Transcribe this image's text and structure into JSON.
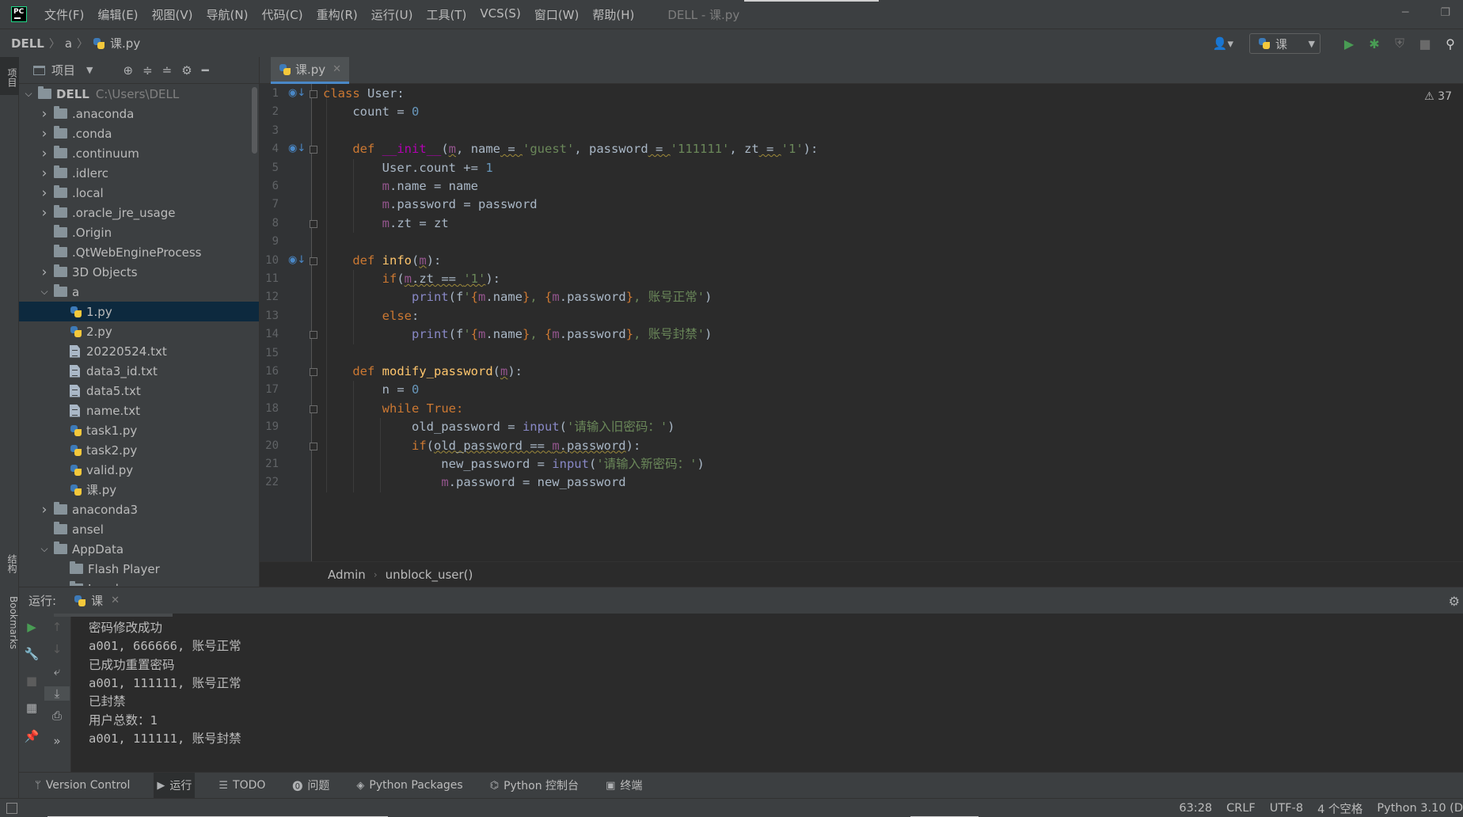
{
  "menubar": {
    "items": [
      "文件(F)",
      "编辑(E)",
      "视图(V)",
      "导航(N)",
      "代码(C)",
      "重构(R)",
      "运行(U)",
      "工具(T)",
      "VCS(S)",
      "窗口(W)",
      "帮助(H)"
    ],
    "window_title": "DELL - 课.py"
  },
  "navbar": {
    "breadcrumb": [
      "DELL",
      "a",
      "课.py"
    ],
    "run_config": "课"
  },
  "left_strip": {
    "project_tab": "项目",
    "structure_tab": "结构",
    "bookmarks_tab": "Bookmarks"
  },
  "project": {
    "title": "项目",
    "root": {
      "name": "DELL",
      "path": "C:\\Users\\DELL"
    },
    "items": [
      {
        "name": ".anaconda",
        "kind": "folder",
        "depth": 1,
        "expanded": false,
        "has_children": true
      },
      {
        "name": ".conda",
        "kind": "folder",
        "depth": 1,
        "expanded": false,
        "has_children": true
      },
      {
        "name": ".continuum",
        "kind": "folder",
        "depth": 1,
        "expanded": false,
        "has_children": true
      },
      {
        "name": ".idlerc",
        "kind": "folder",
        "depth": 1,
        "expanded": false,
        "has_children": true
      },
      {
        "name": ".local",
        "kind": "folder",
        "depth": 1,
        "expanded": false,
        "has_children": true
      },
      {
        "name": ".oracle_jre_usage",
        "kind": "folder",
        "depth": 1,
        "expanded": false,
        "has_children": true
      },
      {
        "name": ".Origin",
        "kind": "folder",
        "depth": 1,
        "expanded": false,
        "has_children": false
      },
      {
        "name": ".QtWebEngineProcess",
        "kind": "folder",
        "depth": 1,
        "expanded": false,
        "has_children": false
      },
      {
        "name": "3D Objects",
        "kind": "folder",
        "depth": 1,
        "expanded": false,
        "has_children": true
      },
      {
        "name": "a",
        "kind": "folder",
        "depth": 1,
        "expanded": true,
        "has_children": true
      },
      {
        "name": "1.py",
        "kind": "py",
        "depth": 2,
        "selected": true
      },
      {
        "name": "2.py",
        "kind": "py",
        "depth": 2
      },
      {
        "name": "20220524.txt",
        "kind": "txt",
        "depth": 2
      },
      {
        "name": "data3_id.txt",
        "kind": "txt",
        "depth": 2
      },
      {
        "name": "data5.txt",
        "kind": "txt",
        "depth": 2
      },
      {
        "name": "name.txt",
        "kind": "txt",
        "depth": 2
      },
      {
        "name": "task1.py",
        "kind": "py",
        "depth": 2
      },
      {
        "name": "task2.py",
        "kind": "py",
        "depth": 2
      },
      {
        "name": "valid.py",
        "kind": "py",
        "depth": 2
      },
      {
        "name": "课.py",
        "kind": "py",
        "depth": 2
      },
      {
        "name": "anaconda3",
        "kind": "folder",
        "depth": 1,
        "expanded": false,
        "has_children": true
      },
      {
        "name": "ansel",
        "kind": "folder",
        "depth": 1,
        "expanded": false,
        "has_children": false
      },
      {
        "name": "AppData",
        "kind": "folder",
        "depth": 1,
        "expanded": true,
        "has_children": true
      },
      {
        "name": "Flash Player",
        "kind": "folder",
        "depth": 2,
        "expanded": false,
        "has_children": false
      },
      {
        "name": "Local",
        "kind": "folder",
        "depth": 2,
        "expanded": true,
        "has_children": true
      }
    ]
  },
  "editor": {
    "tab_label": "课.py",
    "warning_count": "37",
    "line_numbers": [
      "1",
      "2",
      "3",
      "4",
      "5",
      "6",
      "7",
      "8",
      "9",
      "10",
      "11",
      "12",
      "13",
      "14",
      "15",
      "16",
      "17",
      "18",
      "19",
      "20",
      "21",
      "22"
    ],
    "code_lines": [
      [
        {
          "t": "class",
          "c": "kw"
        },
        {
          "t": " User:"
        }
      ],
      [
        {
          "t": "    count = "
        },
        {
          "t": "0",
          "c": "num"
        }
      ],
      [],
      [
        {
          "t": "    "
        },
        {
          "t": "def",
          "c": "kw"
        },
        {
          "t": " "
        },
        {
          "t": "__init__",
          "c": "dunder"
        },
        {
          "t": "("
        },
        {
          "t": "m",
          "c": "self warn-ul"
        },
        {
          "t": ", "
        },
        {
          "t": "name",
          "c": ""
        },
        {
          "t": " = ",
          "c": "warn-ul"
        },
        {
          "t": "'guest'",
          "c": "str"
        },
        {
          "t": ", password"
        },
        {
          "t": " = ",
          "c": "warn-ul"
        },
        {
          "t": "'111111'",
          "c": "str"
        },
        {
          "t": ", zt"
        },
        {
          "t": " = ",
          "c": "warn-ul"
        },
        {
          "t": "'1'",
          "c": "str"
        },
        {
          "t": "):"
        }
      ],
      [
        {
          "t": "        User.count += "
        },
        {
          "t": "1",
          "c": "num"
        }
      ],
      [
        {
          "t": "        "
        },
        {
          "t": "m",
          "c": "self"
        },
        {
          "t": ".name = name"
        }
      ],
      [
        {
          "t": "        "
        },
        {
          "t": "m",
          "c": "self"
        },
        {
          "t": ".password = password"
        }
      ],
      [
        {
          "t": "        "
        },
        {
          "t": "m",
          "c": "self"
        },
        {
          "t": ".zt = zt"
        }
      ],
      [],
      [
        {
          "t": "    "
        },
        {
          "t": "def",
          "c": "kw"
        },
        {
          "t": " "
        },
        {
          "t": "info",
          "c": "fn"
        },
        {
          "t": "("
        },
        {
          "t": "m",
          "c": "self warn-ul"
        },
        {
          "t": "):"
        }
      ],
      [
        {
          "t": "        "
        },
        {
          "t": "if",
          "c": "kw"
        },
        {
          "t": "("
        },
        {
          "t": "m",
          "c": "self warn-ul"
        },
        {
          "t": ".zt == ",
          "c": "warn-ul"
        },
        {
          "t": "'1'",
          "c": "str warn-ul"
        },
        {
          "t": "):"
        }
      ],
      [
        {
          "t": "            "
        },
        {
          "t": "print",
          "c": "bi"
        },
        {
          "t": "(f"
        },
        {
          "t": "'",
          "c": "str"
        },
        {
          "t": "{",
          "c": "fbrace"
        },
        {
          "t": "m",
          "c": "self"
        },
        {
          "t": ".name"
        },
        {
          "t": "}",
          "c": "fbrace"
        },
        {
          "t": ", ",
          "c": "str"
        },
        {
          "t": "{",
          "c": "fbrace"
        },
        {
          "t": "m",
          "c": "self"
        },
        {
          "t": ".password"
        },
        {
          "t": "}",
          "c": "fbrace"
        },
        {
          "t": ", 账号正常'",
          "c": "str"
        },
        {
          "t": ")"
        }
      ],
      [
        {
          "t": "        "
        },
        {
          "t": "else",
          "c": "kw"
        },
        {
          "t": ":"
        }
      ],
      [
        {
          "t": "            "
        },
        {
          "t": "print",
          "c": "bi"
        },
        {
          "t": "(f"
        },
        {
          "t": "'",
          "c": "str"
        },
        {
          "t": "{",
          "c": "fbrace"
        },
        {
          "t": "m",
          "c": "self"
        },
        {
          "t": ".name"
        },
        {
          "t": "}",
          "c": "fbrace"
        },
        {
          "t": ", ",
          "c": "str"
        },
        {
          "t": "{",
          "c": "fbrace"
        },
        {
          "t": "m",
          "c": "self"
        },
        {
          "t": ".password"
        },
        {
          "t": "}",
          "c": "fbrace"
        },
        {
          "t": ", 账号封禁'",
          "c": "str"
        },
        {
          "t": ")"
        }
      ],
      [],
      [
        {
          "t": "    "
        },
        {
          "t": "def",
          "c": "kw"
        },
        {
          "t": " "
        },
        {
          "t": "modify_password",
          "c": "fn"
        },
        {
          "t": "("
        },
        {
          "t": "m",
          "c": "self warn-ul"
        },
        {
          "t": "):"
        }
      ],
      [
        {
          "t": "        n = "
        },
        {
          "t": "0",
          "c": "num"
        }
      ],
      [
        {
          "t": "        "
        },
        {
          "t": "while",
          "c": "kw"
        },
        {
          "t": " "
        },
        {
          "t": "True",
          "c": "kw"
        },
        {
          "t": ":",
          "c": "kw"
        }
      ],
      [
        {
          "t": "            old_password = "
        },
        {
          "t": "input",
          "c": "bi"
        },
        {
          "t": "("
        },
        {
          "t": "'请输入旧密码：'",
          "c": "str"
        },
        {
          "t": ")"
        }
      ],
      [
        {
          "t": "            "
        },
        {
          "t": "if",
          "c": "kw"
        },
        {
          "t": "("
        },
        {
          "t": "old_password == ",
          "c": "warn-ul"
        },
        {
          "t": "m",
          "c": "self warn-ul"
        },
        {
          "t": ".password",
          "c": "warn-ul"
        },
        {
          "t": "):"
        }
      ],
      [
        {
          "t": "                new_password = "
        },
        {
          "t": "input",
          "c": "bi"
        },
        {
          "t": "("
        },
        {
          "t": "'请输入新密码：'",
          "c": "str"
        },
        {
          "t": ")"
        }
      ],
      [
        {
          "t": "                "
        },
        {
          "t": "m",
          "c": "self"
        },
        {
          "t": ".password = new_password"
        }
      ]
    ],
    "breadcrumb": [
      "Admin",
      "unblock_user()"
    ]
  },
  "run": {
    "label": "运行:",
    "tab": "课",
    "output": [
      "密码修改成功",
      "a001, 666666, 账号正常",
      "已成功重置密码",
      "a001, 111111, 账号正常",
      "已封禁",
      "用户总数：1",
      "a001, 111111, 账号封禁"
    ]
  },
  "tool_tabs": [
    {
      "label": "Version Control",
      "icon": "branch-icon"
    },
    {
      "label": "运行",
      "icon": "run-icon",
      "active": true
    },
    {
      "label": "TODO",
      "icon": "list-icon"
    },
    {
      "label": "问题",
      "icon": "problem-icon"
    },
    {
      "label": "Python Packages",
      "icon": "packages-icon"
    },
    {
      "label": "Python 控制台",
      "icon": "console-icon"
    },
    {
      "label": "终端",
      "icon": "terminal-icon"
    }
  ],
  "status": {
    "position": "63:28",
    "line_sep": "CRLF",
    "encoding": "UTF-8",
    "indent": "4 个空格",
    "interpreter": "Python 3.10 (D"
  }
}
